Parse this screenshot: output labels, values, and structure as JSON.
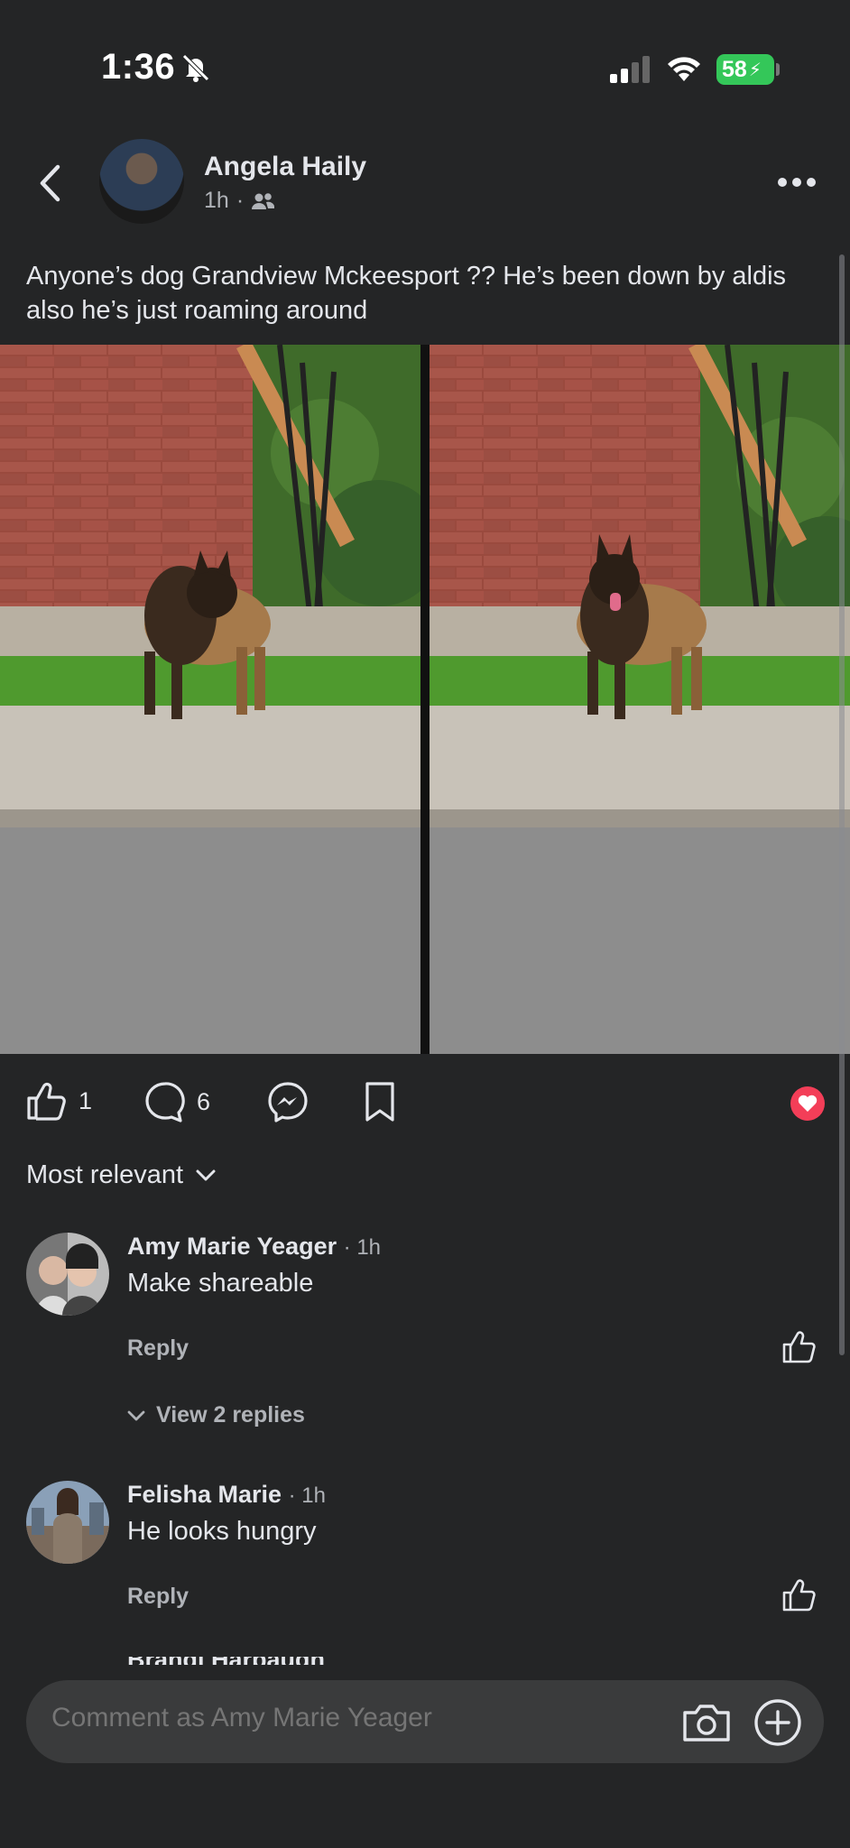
{
  "status_bar": {
    "time": "1:36",
    "battery": "58",
    "icons": [
      "bell-slash-icon",
      "signal-icon",
      "wifi-icon",
      "battery-charging-icon"
    ]
  },
  "post": {
    "author": "Angela Haily",
    "time": "1h",
    "separator": "·",
    "audience_icon": "friends-icon",
    "text": "Anyone’s dog Grandview Mckeesport ?? He’s been down by aldis also he’s just roaming around",
    "like_count": "1",
    "comment_count": "6"
  },
  "sort": {
    "label": "Most relevant"
  },
  "comments": [
    {
      "name": "Amy Marie Yeager",
      "time": "· 1h",
      "text": "Make shareable",
      "reply": "Reply",
      "view_replies": "View 2 replies"
    },
    {
      "name": "Felisha Marie",
      "time": "· 1h",
      "text": "He looks hungry",
      "reply": "Reply"
    }
  ],
  "partial_comment": {
    "name": "Brandi Harbaugh"
  },
  "composer": {
    "placeholder": "Comment as Amy Marie Yeager"
  },
  "colors": {
    "background": "#242526",
    "text": "#e4e6eb",
    "secondary": "#b0b3b8",
    "love": "#f33e58",
    "battery": "#34c759"
  }
}
